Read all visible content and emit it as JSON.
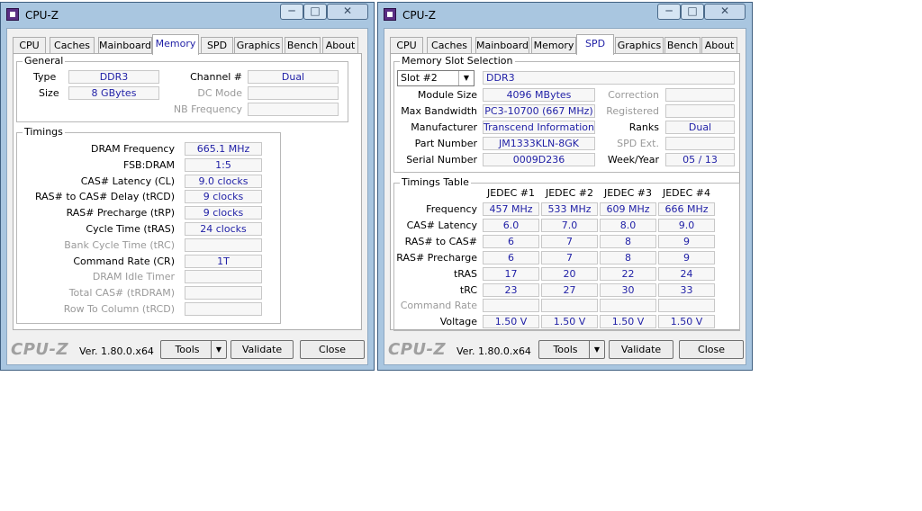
{
  "windows": [
    {
      "title": "CPU-Z",
      "tabs": [
        "CPU",
        "Caches",
        "Mainboard",
        "Memory",
        "SPD",
        "Graphics",
        "Bench",
        "About"
      ],
      "active_tab": "Memory",
      "general": {
        "legend": "General",
        "type_label": "Type",
        "type_value": "DDR3",
        "size_label": "Size",
        "size_value": "8 GBytes",
        "channel_label": "Channel #",
        "channel_value": "Dual",
        "dc_mode_label": "DC Mode",
        "dc_mode_value": "",
        "nb_freq_label": "NB Frequency",
        "nb_freq_value": ""
      },
      "timings": {
        "legend": "Timings",
        "rows": [
          {
            "label": "DRAM Frequency",
            "value": "665.1 MHz",
            "disabled": false
          },
          {
            "label": "FSB:DRAM",
            "value": "1:5",
            "disabled": false
          },
          {
            "label": "CAS# Latency (CL)",
            "value": "9.0 clocks",
            "disabled": false
          },
          {
            "label": "RAS# to CAS# Delay (tRCD)",
            "value": "9 clocks",
            "disabled": false
          },
          {
            "label": "RAS# Precharge (tRP)",
            "value": "9 clocks",
            "disabled": false
          },
          {
            "label": "Cycle Time (tRAS)",
            "value": "24 clocks",
            "disabled": false
          },
          {
            "label": "Bank Cycle Time (tRC)",
            "value": "",
            "disabled": true
          },
          {
            "label": "Command Rate (CR)",
            "value": "1T",
            "disabled": false
          },
          {
            "label": "DRAM Idle Timer",
            "value": "",
            "disabled": true
          },
          {
            "label": "Total CAS# (tRDRAM)",
            "value": "",
            "disabled": true
          },
          {
            "label": "Row To Column (tRCD)",
            "value": "",
            "disabled": true
          }
        ]
      },
      "footer": {
        "brand": "CPU-Z",
        "version": "Ver. 1.80.0.x64",
        "tools": "Tools",
        "validate": "Validate",
        "close": "Close"
      }
    },
    {
      "title": "CPU-Z",
      "tabs": [
        "CPU",
        "Caches",
        "Mainboard",
        "Memory",
        "SPD",
        "Graphics",
        "Bench",
        "About"
      ],
      "active_tab": "SPD",
      "slot": {
        "legend": "Memory Slot Selection",
        "selected": "Slot #2",
        "type_value": "DDR3",
        "module_size_label": "Module Size",
        "module_size_value": "4096 MBytes",
        "max_bw_label": "Max Bandwidth",
        "max_bw_value": "PC3-10700 (667 MHz)",
        "manufacturer_label": "Manufacturer",
        "manufacturer_value": "Transcend Information",
        "part_label": "Part Number",
        "part_value": "JM1333KLN-8GK",
        "serial_label": "Serial Number",
        "serial_value": "0009D236",
        "correction_label": "Correction",
        "correction_value": "",
        "registered_label": "Registered",
        "registered_value": "",
        "ranks_label": "Ranks",
        "ranks_value": "Dual",
        "spd_ext_label": "SPD Ext.",
        "spd_ext_value": "",
        "week_label": "Week/Year",
        "week_value": "05 / 13"
      },
      "timings_table": {
        "legend": "Timings Table",
        "columns": [
          "JEDEC #1",
          "JEDEC #2",
          "JEDEC #3",
          "JEDEC #4"
        ],
        "rows": [
          {
            "label": "Frequency",
            "values": [
              "457 MHz",
              "533 MHz",
              "609 MHz",
              "666 MHz"
            ],
            "disabled": false
          },
          {
            "label": "CAS# Latency",
            "values": [
              "6.0",
              "7.0",
              "8.0",
              "9.0"
            ],
            "disabled": false
          },
          {
            "label": "RAS# to CAS#",
            "values": [
              "6",
              "7",
              "8",
              "9"
            ],
            "disabled": false
          },
          {
            "label": "RAS# Precharge",
            "values": [
              "6",
              "7",
              "8",
              "9"
            ],
            "disabled": false
          },
          {
            "label": "tRAS",
            "values": [
              "17",
              "20",
              "22",
              "24"
            ],
            "disabled": false
          },
          {
            "label": "tRC",
            "values": [
              "23",
              "27",
              "30",
              "33"
            ],
            "disabled": false
          },
          {
            "label": "Command Rate",
            "values": [
              "",
              "",
              "",
              ""
            ],
            "disabled": true
          },
          {
            "label": "Voltage",
            "values": [
              "1.50 V",
              "1.50 V",
              "1.50 V",
              "1.50 V"
            ],
            "disabled": false
          }
        ]
      },
      "footer": {
        "brand": "CPU-Z",
        "version": "Ver. 1.80.0.x64",
        "tools": "Tools",
        "validate": "Validate",
        "close": "Close"
      }
    }
  ],
  "colors": {
    "window_frame": "#a9c6e0",
    "value_text": "#1f1fa6",
    "disabled_text": "#9a9a9a"
  }
}
